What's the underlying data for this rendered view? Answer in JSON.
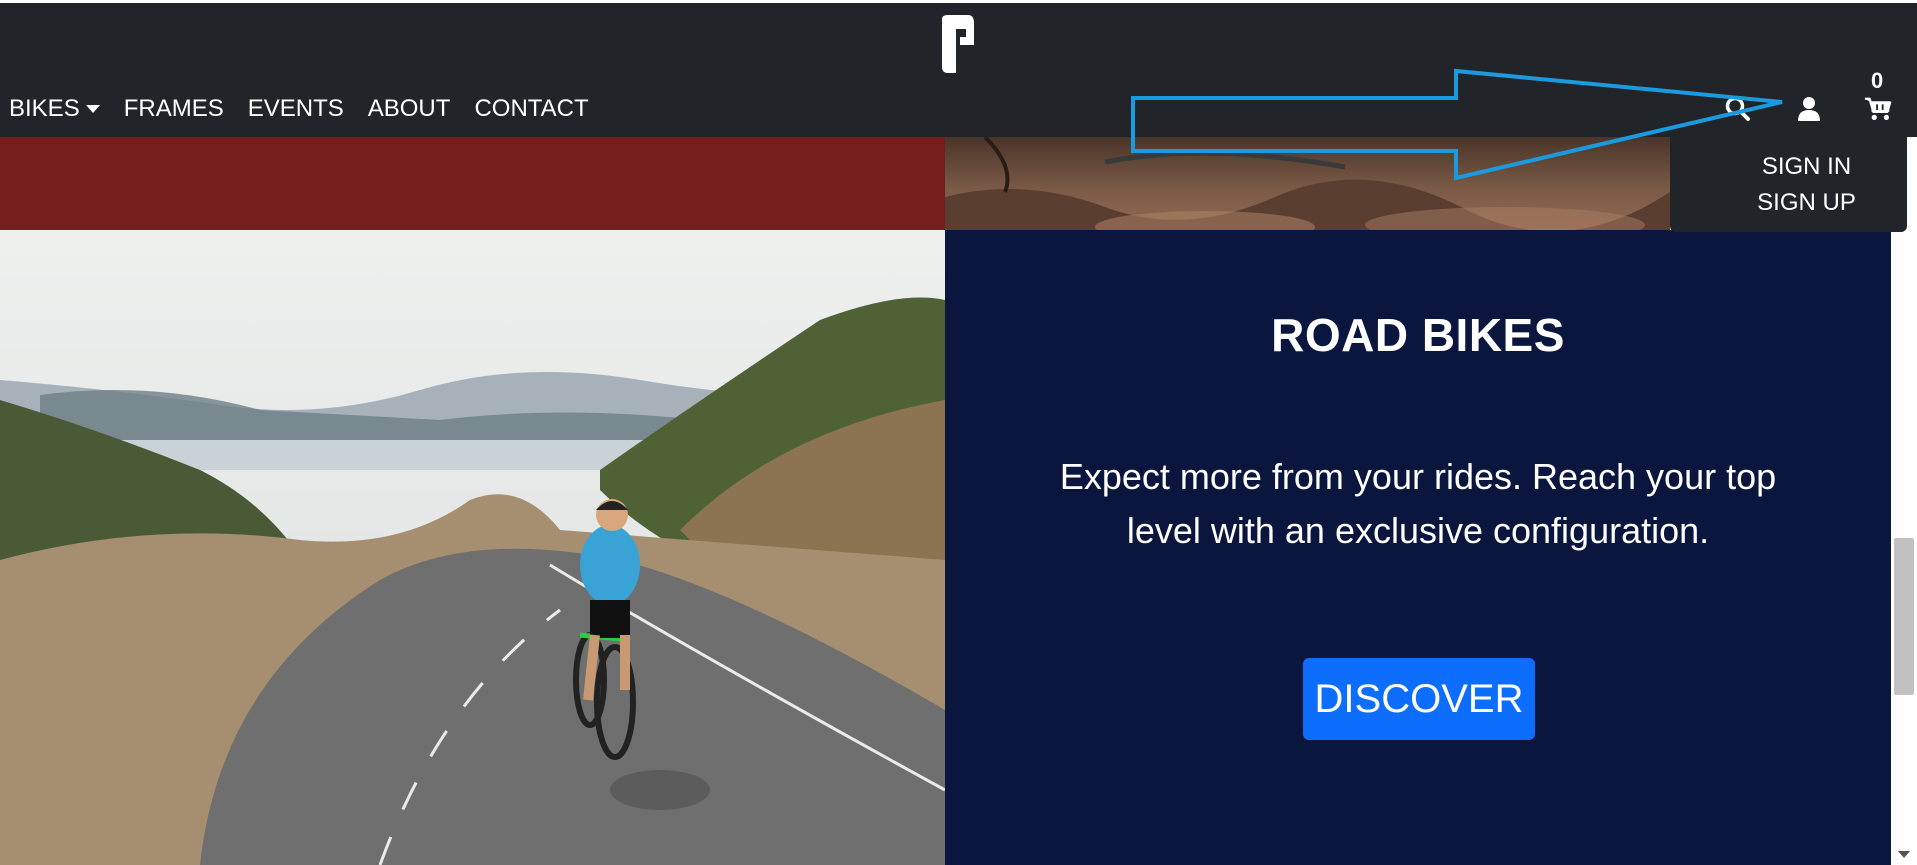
{
  "header": {
    "logo_icon": "brand-logo-icon",
    "nav": [
      {
        "label": "BIKES",
        "has_dropdown": true
      },
      {
        "label": "FRAMES"
      },
      {
        "label": "EVENTS"
      },
      {
        "label": "ABOUT"
      },
      {
        "label": "CONTACT"
      }
    ],
    "icons": [
      "search-icon",
      "user-icon",
      "cart-icon"
    ],
    "cart_count": "0"
  },
  "user_menu": {
    "items": [
      "SIGN IN",
      "SIGN UP"
    ]
  },
  "hero": {
    "title": "ROAD BIKES",
    "description": "Expect more from your rides. Reach your top level with an exclusive configuration.",
    "button_label": "DISCOVER"
  },
  "colors": {
    "header_bg": "#212529",
    "panel_bg": "#0b163f",
    "accent_red": "#751c1c",
    "button_blue": "#0d6efd",
    "annotation_blue": "#1a9be0"
  }
}
